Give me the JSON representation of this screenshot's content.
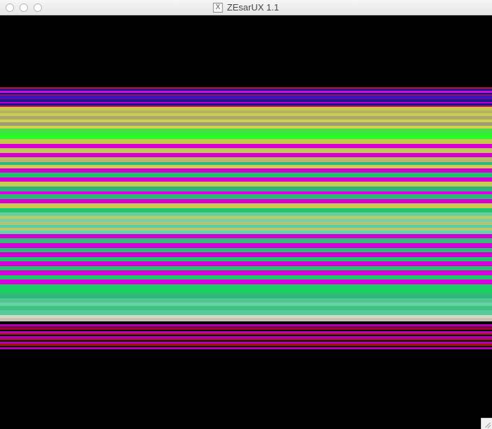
{
  "window": {
    "title": "ZEsarUX 1.1",
    "app_icon_glyph": "X"
  },
  "display": {
    "stripes": [
      {
        "color": "#000000",
        "h": 94
      },
      {
        "color": "#c81414",
        "h": 2
      },
      {
        "color": "#1a1aa0",
        "h": 3
      },
      {
        "color": "#d00cd0",
        "h": 2
      },
      {
        "color": "#000088",
        "h": 2
      },
      {
        "color": "#b00060",
        "h": 2
      },
      {
        "color": "#2020c0",
        "h": 3
      },
      {
        "color": "#7000a0",
        "h": 2
      },
      {
        "color": "#181898",
        "h": 3
      },
      {
        "color": "#c000c0",
        "h": 2
      },
      {
        "color": "#101090",
        "h": 3
      },
      {
        "color": "#d01050",
        "h": 2
      },
      {
        "color": "#c8c84e",
        "h": 4
      },
      {
        "color": "#b4b460",
        "h": 4
      },
      {
        "color": "#cccc55",
        "h": 4
      },
      {
        "color": "#a8a870",
        "h": 4
      },
      {
        "color": "#d0d04e",
        "h": 4
      },
      {
        "color": "#9c9c78",
        "h": 4
      },
      {
        "color": "#d2d24a",
        "h": 4
      },
      {
        "color": "#44e044",
        "h": 6
      },
      {
        "color": "#30f030",
        "h": 4
      },
      {
        "color": "#20ff20",
        "h": 4
      },
      {
        "color": "#c8c850",
        "h": 6
      },
      {
        "color": "#d800d8",
        "h": 6
      },
      {
        "color": "#c4c460",
        "h": 6
      },
      {
        "color": "#d000d0",
        "h": 6
      },
      {
        "color": "#b8b868",
        "h": 6
      },
      {
        "color": "#32b480",
        "h": 4
      },
      {
        "color": "#cccc55",
        "h": 4
      },
      {
        "color": "#d000d0",
        "h": 6
      },
      {
        "color": "#22c070",
        "h": 6
      },
      {
        "color": "#d000d0",
        "h": 6
      },
      {
        "color": "#c8c854",
        "h": 6
      },
      {
        "color": "#2ab47c",
        "h": 6
      },
      {
        "color": "#e000e0",
        "h": 4
      },
      {
        "color": "#30b878",
        "h": 6
      },
      {
        "color": "#d400d4",
        "h": 6
      },
      {
        "color": "#c8c852",
        "h": 6
      },
      {
        "color": "#28c46c",
        "h": 6
      },
      {
        "color": "#60d0a0",
        "h": 4
      },
      {
        "color": "#c0c860",
        "h": 4
      },
      {
        "color": "#70d0b0",
        "h": 4
      },
      {
        "color": "#a8c878",
        "h": 4
      },
      {
        "color": "#5ccca4",
        "h": 4
      },
      {
        "color": "#b8c86c",
        "h": 4
      },
      {
        "color": "#68d0ac",
        "h": 4
      },
      {
        "color": "#d000d0",
        "h": 6
      },
      {
        "color": "#3ab880",
        "h": 6
      },
      {
        "color": "#d800d8",
        "h": 6
      },
      {
        "color": "#30bc78",
        "h": 6
      },
      {
        "color": "#d000d0",
        "h": 6
      },
      {
        "color": "#28c070",
        "h": 6
      },
      {
        "color": "#d400d4",
        "h": 6
      },
      {
        "color": "#24c46c",
        "h": 6
      },
      {
        "color": "#d800d8",
        "h": 6
      },
      {
        "color": "#20c868",
        "h": 6
      },
      {
        "color": "#dc00dc",
        "h": 6
      },
      {
        "color": "#1ccc64",
        "h": 6
      },
      {
        "color": "#18d060",
        "h": 6
      },
      {
        "color": "#30b87c",
        "h": 6
      },
      {
        "color": "#50c890",
        "h": 6
      },
      {
        "color": "#68d0a4",
        "h": 4
      },
      {
        "color": "#40c284",
        "h": 6
      },
      {
        "color": "#58cc98",
        "h": 6
      },
      {
        "color": "#d8d8c8",
        "h": 4
      },
      {
        "color": "#c4c4b0",
        "h": 4
      },
      {
        "color": "#000000",
        "h": 4
      },
      {
        "color": "#b000b0",
        "h": 3
      },
      {
        "color": "#600060",
        "h": 2
      },
      {
        "color": "#a80028",
        "h": 2
      },
      {
        "color": "#000000",
        "h": 2
      },
      {
        "color": "#b800b8",
        "h": 3
      },
      {
        "color": "#aa1818",
        "h": 2
      },
      {
        "color": "#000000",
        "h": 2
      },
      {
        "color": "#ac00ac",
        "h": 3
      },
      {
        "color": "#a81414",
        "h": 2
      },
      {
        "color": "#000000",
        "h": 2
      },
      {
        "color": "#b400b4",
        "h": 3
      },
      {
        "color": "#a41010",
        "h": 2
      },
      {
        "color": "#000000",
        "h": 2
      },
      {
        "color": "#b000b0",
        "h": 3
      },
      {
        "color": "#000000",
        "h": 104
      }
    ]
  }
}
